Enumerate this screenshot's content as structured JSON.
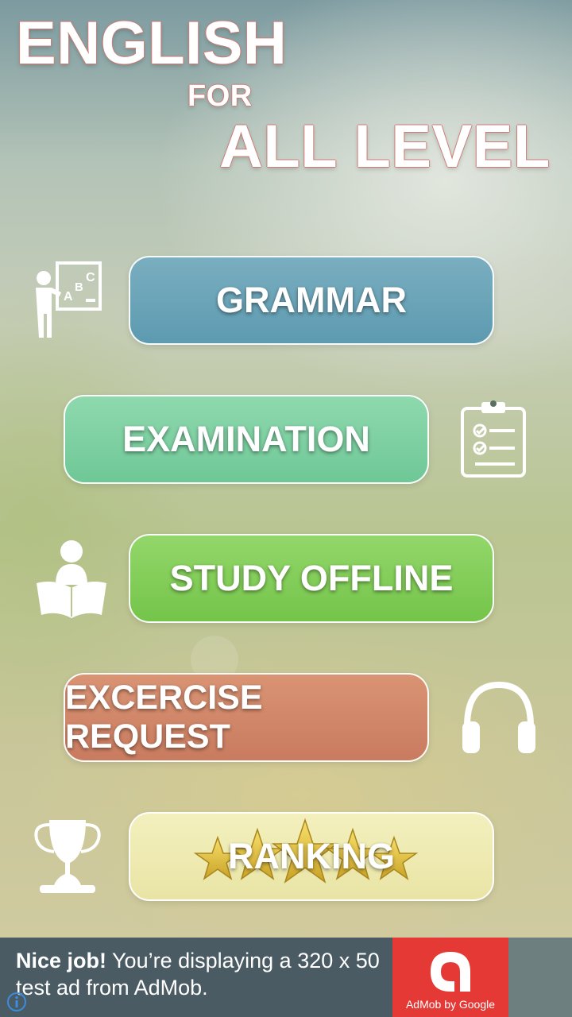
{
  "header": {
    "title_line1": "ENGLISH",
    "title_line2": "FOR",
    "title_line3": "ALL LEVEL"
  },
  "menu": {
    "grammar": "GRAMMAR",
    "examination": "EXAMINATION",
    "study_offline": "STUDY OFFLINE",
    "exercise_request": "EXCERCISE REQUEST",
    "ranking": "RANKING"
  },
  "icons": {
    "grammar": "teacher-blackboard-icon",
    "examination": "clipboard-checklist-icon",
    "study_offline": "reader-book-icon",
    "exercise_request": "headphones-icon",
    "ranking": "trophy-icon",
    "ranking_decoration": "gold-stars-icon"
  },
  "ad": {
    "headline": "Nice job!",
    "body": "You’re displaying a 320 x 50 test ad from AdMob.",
    "brand": "AdMob by Google"
  },
  "colors": {
    "grammar": "#6aa5b9",
    "examination": "#7fd0a2",
    "study_offline": "#84ce5a",
    "exercise_request": "#d18669",
    "ranking": "#eeeab1",
    "ad_background": "#4a5b64",
    "ad_logo": "#e53935"
  }
}
